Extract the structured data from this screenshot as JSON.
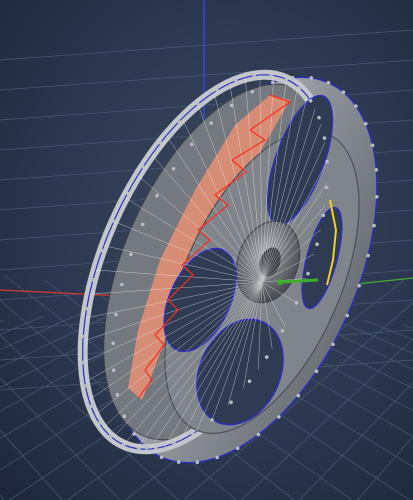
{
  "viewport": {
    "view": "perspective",
    "background_color": "#2f3b52",
    "grid_color": "#4a5a74",
    "axes": {
      "x_color": "#d23a2a",
      "y_color": "#3fae2a",
      "z_color": "#2f4ad8"
    }
  },
  "model": {
    "object": "wheel-rim-mesh",
    "mesh_color": "#8e9299",
    "wireframe_color": "#e8e8ea",
    "vertex_color": "#b9bcc2",
    "selected_edge_color": "#ff2a1a",
    "selected_face_color": "#e98f74",
    "boundary_edge_color": "#2b2fb8",
    "highlight_edge_color": "#f2d020"
  }
}
